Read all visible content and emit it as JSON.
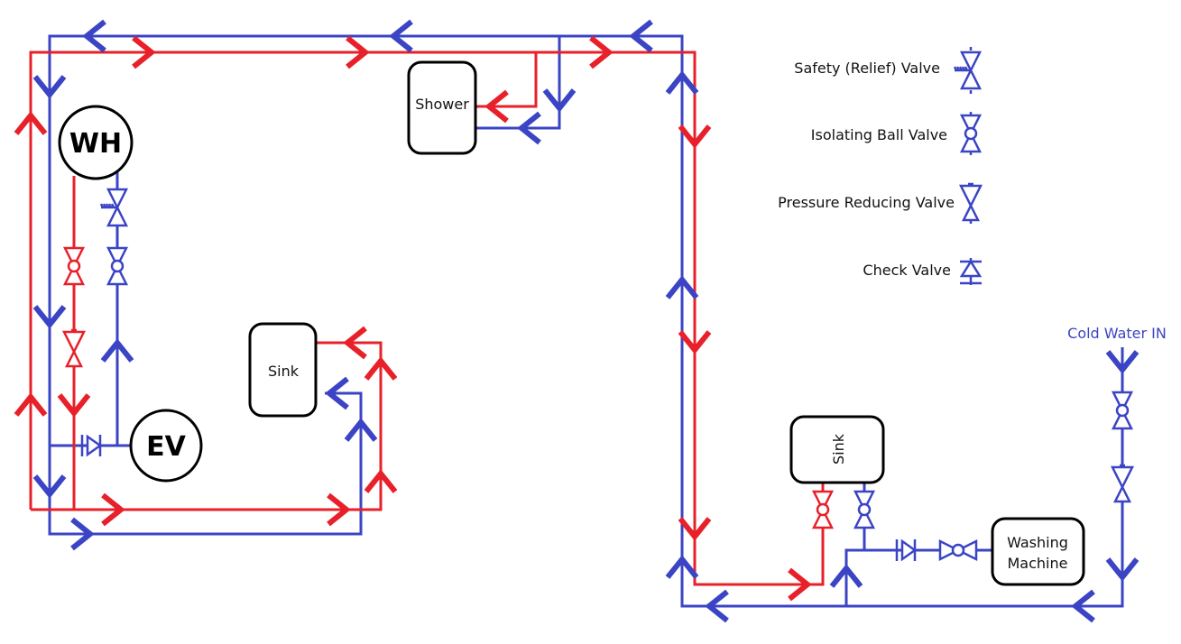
{
  "colors": {
    "hot": "#e8202a",
    "cold": "#3b44c4",
    "outline": "#000000"
  },
  "appliances": {
    "water_heater": "WH",
    "expansion_vessel": "EV"
  },
  "fixtures": {
    "shower": "Shower",
    "sink_left": "Sink",
    "sink_right": "Sink",
    "washing_machine_line1": "Washing",
    "washing_machine_line2": "Machine"
  },
  "inlet": {
    "label": "Cold Water IN"
  },
  "legend": [
    {
      "label": "Safety (Relief) Valve",
      "symbol": "safety-relief-valve"
    },
    {
      "label": "Isolating Ball Valve",
      "symbol": "isolating-ball-valve"
    },
    {
      "label": "Pressure Reducing Valve",
      "symbol": "pressure-reducing-valve"
    },
    {
      "label": "Check Valve",
      "symbol": "check-valve"
    }
  ]
}
